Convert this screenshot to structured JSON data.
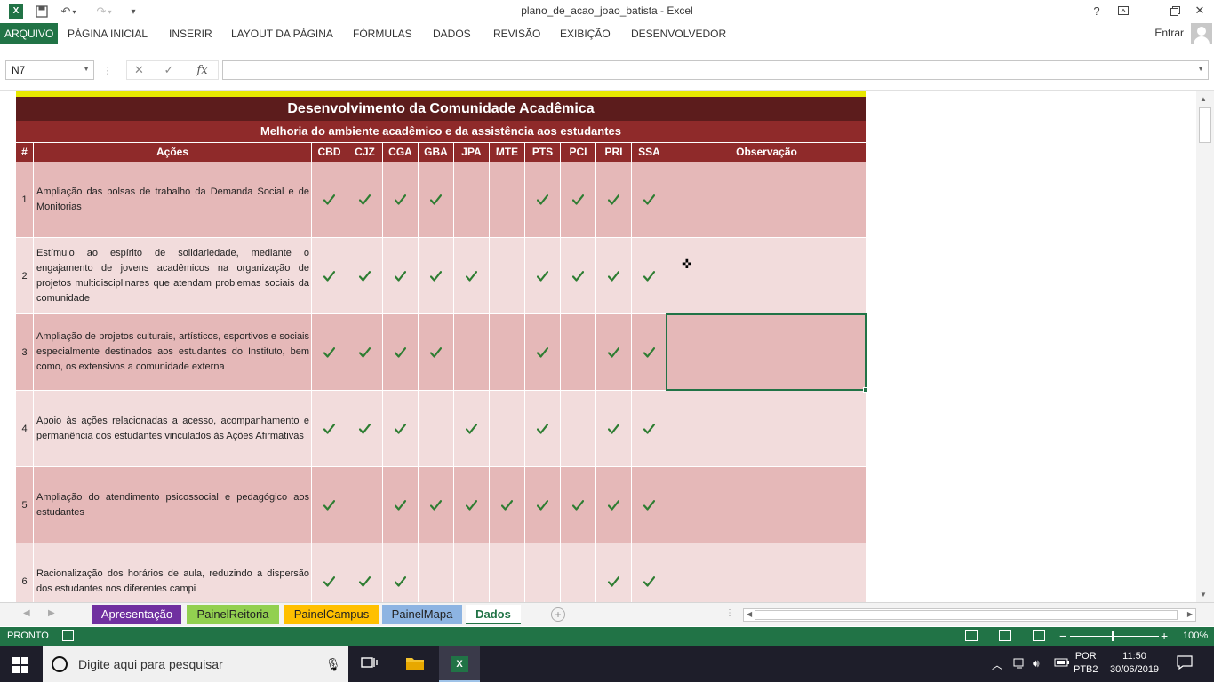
{
  "window": {
    "title": "plano_de_acao_joao_batista - Excel",
    "help": "?",
    "controls": [
      "Ribbon display options",
      "Minimize",
      "Restore",
      "Close"
    ]
  },
  "ribbon": {
    "tabs": [
      "ARQUIVO",
      "PÁGINA INICIAL",
      "INSERIR",
      "LAYOUT DA PÁGINA",
      "FÓRMULAS",
      "DADOS",
      "REVISÃO",
      "EXIBIÇÃO",
      "DESENVOLVEDOR"
    ],
    "signin": "Entrar"
  },
  "formula_bar": {
    "name_box": "N7",
    "fx": "fx",
    "value": ""
  },
  "sheet": {
    "title": "Desenvolvimento da Comunidade Acadêmica",
    "subtitle": "Melhoria do ambiente acadêmico e da assistência aos estudantes",
    "headers": {
      "num": "#",
      "actions": "Ações",
      "campuses": [
        "CBD",
        "CJZ",
        "CGA",
        "GBA",
        "JPA",
        "MTE",
        "PTS",
        "PCI",
        "PRI",
        "SSA"
      ],
      "observation": "Observação"
    },
    "rows": [
      {
        "n": "1",
        "text": "Ampliação das bolsas de trabalho da Demanda Social e de Monitorias",
        "checks": [
          1,
          1,
          1,
          1,
          0,
          0,
          1,
          1,
          1,
          1
        ]
      },
      {
        "n": "2",
        "text": "Estímulo ao espírito de solidariedade, mediante o engajamento de jovens acadêmicos na organização de projetos multidisciplinares que atendam problemas sociais da comunidade",
        "checks": [
          1,
          1,
          1,
          1,
          1,
          0,
          1,
          1,
          1,
          1
        ]
      },
      {
        "n": "3",
        "text": "Ampliação de projetos culturais, artísticos, esportivos e sociais especialmente destinados aos estudantes do Instituto, bem como, os extensivos a comunidade externa",
        "checks": [
          1,
          1,
          1,
          1,
          0,
          0,
          1,
          0,
          1,
          1
        ]
      },
      {
        "n": "4",
        "text": "Apoio às ações relacionadas a acesso, acompanhamento e permanência dos estudantes vinculados às Ações Afirmativas",
        "checks": [
          1,
          1,
          1,
          0,
          1,
          0,
          1,
          0,
          1,
          1
        ]
      },
      {
        "n": "5",
        "text": "Ampliação do atendimento psicossocial e pedagógico aos estudantes",
        "checks": [
          1,
          0,
          1,
          1,
          1,
          1,
          1,
          1,
          1,
          1
        ]
      },
      {
        "n": "6",
        "text": "Racionalização dos horários de aula, reduzindo a dispersão dos estudantes nos diferentes campi",
        "checks": [
          1,
          1,
          1,
          0,
          0,
          0,
          0,
          0,
          1,
          1
        ]
      }
    ]
  },
  "sheet_tabs": [
    {
      "label": "Apresentação",
      "color": "#7030a0",
      "text": "#ffffff"
    },
    {
      "label": "PainelReitoria",
      "color": "#92d050",
      "text": "#222222"
    },
    {
      "label": "PainelCampus",
      "color": "#ffc000",
      "text": "#222222"
    },
    {
      "label": "PainelMapa",
      "color": "#8db4e2",
      "text": "#222222"
    },
    {
      "label": "Dados",
      "color": "#ffffff",
      "text": "#217346"
    }
  ],
  "status": {
    "ready": "PRONTO",
    "zoom": "100%"
  },
  "taskbar": {
    "search_placeholder": "Digite aqui para pesquisar",
    "lang_top": "POR",
    "lang_bottom": "PTB2",
    "time": "11:50",
    "date": "30/06/2019"
  },
  "colors": {
    "excel_green": "#217346",
    "title_band": "#5c1c1c",
    "header_band": "#8f2a2a",
    "row_dark": "#e5b8b8",
    "row_light": "#f2dcdc",
    "check": "#2e7d32"
  }
}
